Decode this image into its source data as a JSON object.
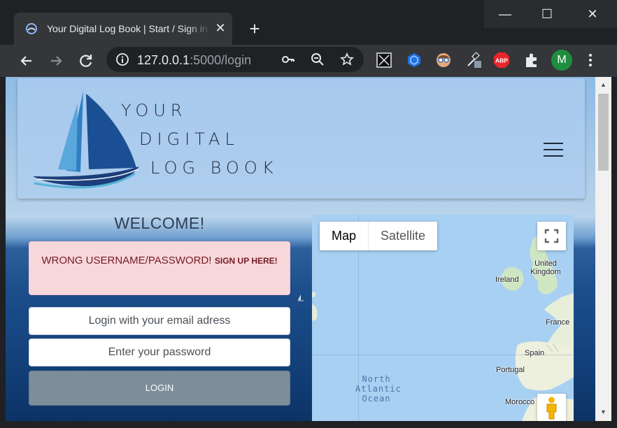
{
  "browser": {
    "tab_title": "Your Digital Log Book | Start / Sign in",
    "tab_close": "✕",
    "new_tab": "+",
    "url_host": "127.0.0.1",
    "url_path": ":5000/login",
    "profile_initial": "M",
    "window_controls": {
      "minimize": "—",
      "maximize": "☐",
      "close": "✕"
    },
    "extensions": [
      "puzzle-extension-icon",
      "blue-cube-extension-icon",
      "cartoon-face-extension-icon",
      "eyedropper-extension-icon",
      "adblock-plus-icon",
      "extensions-puzzle-icon"
    ],
    "abp_label": "ABP"
  },
  "header": {
    "brand_line1": "YOUR",
    "brand_line2": "DIGITAL",
    "brand_line3": "LOG BOOK"
  },
  "login": {
    "welcome": "WELCOME!",
    "alert_message": "WRONG USERNAME/PASSWORD!",
    "alert_link": "SIGN UP HERE!",
    "email_placeholder": "Login with your email adress",
    "password_placeholder": "Enter your password",
    "login_button": "LOGIN"
  },
  "map": {
    "type_options": [
      "Map",
      "Satellite"
    ],
    "active_type": "Map",
    "labels": {
      "uk": "United Kingdom",
      "ireland": "Ireland",
      "france": "France",
      "spain": "Spain",
      "portugal": "Portugal",
      "morocco": "Morocco",
      "ocean": "North Atlantic Ocean"
    }
  }
}
